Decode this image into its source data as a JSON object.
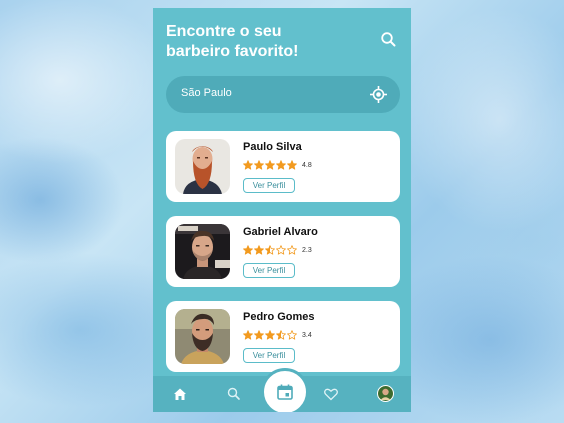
{
  "header": {
    "title_line1": "Encontre o seu",
    "title_line2": "barbeiro favorito!",
    "search_icon": "search-icon"
  },
  "location": {
    "value": "São Paulo",
    "icon": "gps-crosshair-icon"
  },
  "barbers": [
    {
      "name": "Paulo Silva",
      "rating": 4.8,
      "rating_label": "4.8",
      "button": "Ver Perfil",
      "photo": "red-bearded-man"
    },
    {
      "name": "Gabriel Alvaro",
      "rating": 2.3,
      "rating_label": "2.3",
      "button": "Ver Perfil",
      "photo": "man-dark-background"
    },
    {
      "name": "Pedro Gomes",
      "rating": 3.4,
      "rating_label": "3.4",
      "button": "Ver Perfil",
      "photo": "bearded-man-outdoor"
    }
  ],
  "bottom_nav": {
    "items": [
      "home-icon",
      "search-icon",
      "calendar-icon",
      "heart-icon",
      "profile-avatar"
    ],
    "active": "home-icon"
  },
  "colors": {
    "app_background": "#62c0cd",
    "location_bar": "#4fabb9",
    "nav_bar": "#56b2c0",
    "star": "#f29a1f",
    "accent": "#5bbcc9"
  }
}
